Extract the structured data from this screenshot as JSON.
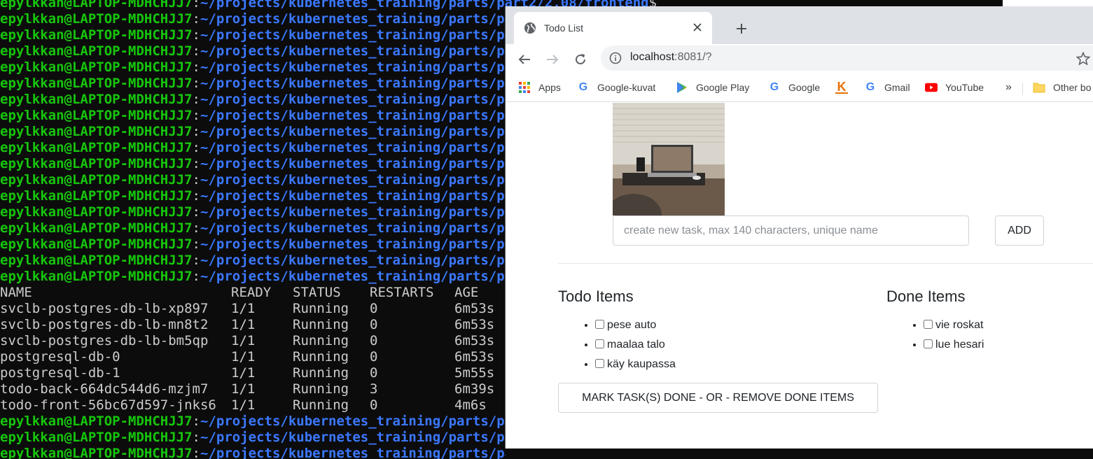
{
  "terminal": {
    "prompt_user": "epylkkan@LAPTOP-MDHCHJJ7",
    "prompt_path_full": "~/projects/kubernetes_training/parts/part2/2.08/frontend",
    "prompt_path_short": "~/projects/kubernetes_training/parts/part",
    "dollar": "$",
    "headers": {
      "name": "NAME",
      "ready": "READY",
      "status": "STATUS",
      "restarts": "RESTARTS",
      "age": "AGE"
    },
    "pods": [
      {
        "name": "svclb-postgres-db-lb-xp897",
        "ready": "1/1",
        "status": "Running",
        "restarts": "0",
        "age": "6m53s"
      },
      {
        "name": "svclb-postgres-db-lb-mn8t2",
        "ready": "1/1",
        "status": "Running",
        "restarts": "0",
        "age": "6m53s"
      },
      {
        "name": "svclb-postgres-db-lb-bm5qp",
        "ready": "1/1",
        "status": "Running",
        "restarts": "0",
        "age": "6m53s"
      },
      {
        "name": "postgresql-db-0",
        "ready": "1/1",
        "status": "Running",
        "restarts": "0",
        "age": "6m53s"
      },
      {
        "name": "postgresql-db-1",
        "ready": "1/1",
        "status": "Running",
        "restarts": "0",
        "age": "5m55s"
      },
      {
        "name": "todo-back-664dc544d6-mzjm7",
        "ready": "1/1",
        "status": "Running",
        "restarts": "3",
        "age": "6m39s"
      },
      {
        "name": "todo-front-56bc67d597-jnks6",
        "ready": "1/1",
        "status": "Running",
        "restarts": "0",
        "age": "4m6s"
      }
    ]
  },
  "browser": {
    "tab_title": "Todo List",
    "url_host": "localhost",
    "url_rest": ":8081/?",
    "bookmarks": [
      "Apps",
      "Google-kuvat",
      "Google Play",
      "Google",
      "",
      "Gmail",
      "YouTube",
      "»",
      "Other bo"
    ]
  },
  "page": {
    "input_placeholder": "create new task, max 140 characters, unique name",
    "add_label": "ADD",
    "todo_title": "Todo Items",
    "done_title": "Done Items",
    "todo_items": [
      "pese auto",
      "maalaa talo",
      "käy kaupassa"
    ],
    "done_items": [
      "vie roskat",
      "lue hesari"
    ],
    "mark_label": "MARK TASK(S) DONE - OR - REMOVE DONE ITEMS"
  }
}
